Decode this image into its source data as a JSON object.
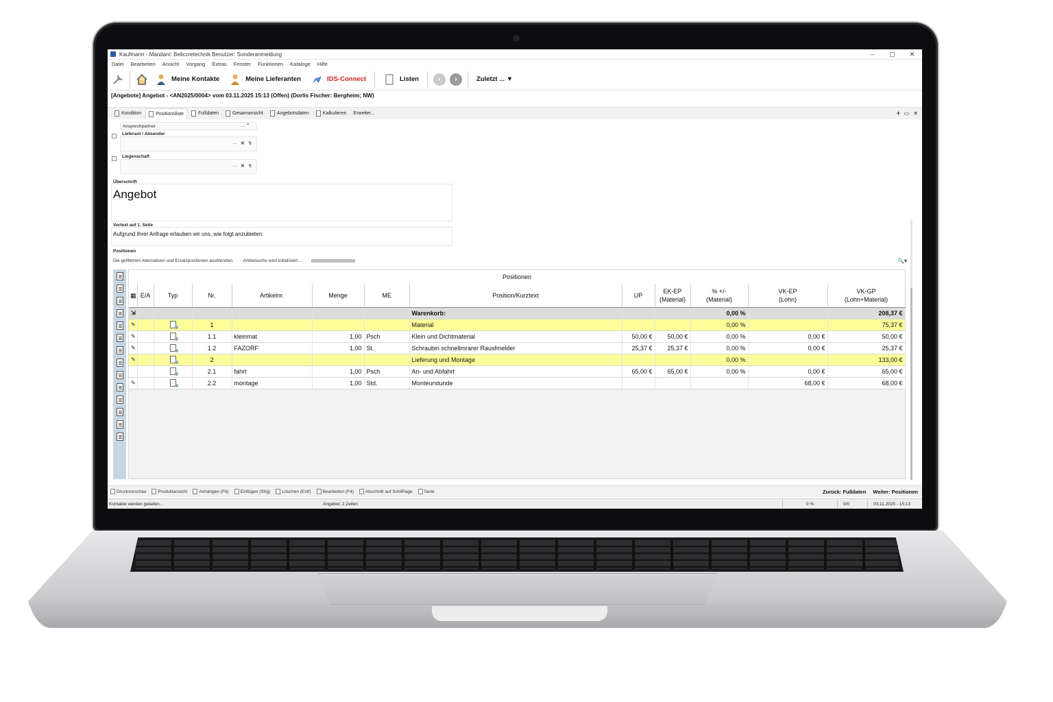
{
  "window": {
    "title": "Kaufmann - Mandant: Beliccretechnik Benutzer: Sonderanmeldung",
    "controls": [
      "–",
      "▢",
      "✕"
    ]
  },
  "menu": [
    "Datei",
    "Bearbeiten",
    "Ansicht",
    "Vorgang",
    "Extras",
    "Fenster",
    "Funktionen",
    "Kataloge",
    "Hilfe"
  ],
  "toolbar": {
    "contacts": "Meine Kontakte",
    "suppliers": "Meine Lieferanten",
    "ids": "IDS-Connect",
    "lists": "Listen",
    "recent": "Zuletzt ... ▼"
  },
  "document_line": "[Angebote] Angebot - <AN2025/0004> vom 03.11.2025 15:13 (Offen) (Dorlis Fischer: Bergheim; NW)",
  "tabs": [
    "Kondition",
    "Positionsliste",
    "Fußdaten",
    "Gesamansicht",
    "Angebotsdaten",
    "Kalkulieren",
    "Erweiter..."
  ],
  "form": {
    "ansprechpartner_label": "Ansprechpartner",
    "lieferant_label": "Lieferant / Absender",
    "liegenschaft_label": "Liegenschaft",
    "ueberschrift_label": "Überschrift",
    "ueberschrift_value": "Angebot",
    "vortext_label": "Vortext auf 1. Seite",
    "vortext_value": "Aufgrund Ihrer Anfrage erlauben wir uns, wie folgt anzubieten:",
    "positionen_label": "Positionen",
    "hint": "Die gefilterten Alternativen und Ersatzpositionen ausblenden.",
    "artikelsuche": "Artikelsuche wird initialisiert..."
  },
  "grid": {
    "caption": "Positionen",
    "headers": [
      "E/A",
      "Typ",
      "Nr.",
      "Artikelnr.",
      "Menge",
      "ME",
      "Position/Kurztext",
      "UP",
      "EK-EP\n(Material)",
      "% +/-\n(Material)",
      "VK-EP\n(Lohn)",
      "VK-GP\n(Lohn+Material)"
    ],
    "total": {
      "label": "Warenkorb:",
      "percent": "0,00 %",
      "sum": "208,37 €"
    },
    "rows": [
      {
        "style": "yellow",
        "nr": "1",
        "artikel": "",
        "menge": "",
        "me": "",
        "text": "Material",
        "up": "",
        "ek": "",
        "pct": "0,00 %",
        "vkep": "",
        "vkgp": "75,37 €"
      },
      {
        "style": "",
        "nr": "1.1",
        "artikel": "kleinmat",
        "menge": "1,00",
        "me": "Psch",
        "text": "Klein und Dichtmaterial",
        "up": "50,00 €",
        "ek": "50,00 €",
        "pct": "0,00 %",
        "vkep": "0,00 €",
        "vkgp": "50,00 €"
      },
      {
        "style": "",
        "nr": "1.2",
        "artikel": "FAZORF",
        "menge": "1,00",
        "me": "St.",
        "text": "Schraubin schnellmrarer Rausfmelder",
        "up": "25,37 €",
        "ek": "25,37 €",
        "pct": "0,00 %",
        "vkep": "0,00 €",
        "vkgp": "25,37 €"
      },
      {
        "style": "yellow",
        "nr": "2",
        "artikel": "",
        "menge": "",
        "me": "",
        "text": "Lieferung und Montage",
        "up": "",
        "ek": "",
        "pct": "0,00 %",
        "vkep": "",
        "vkgp": "133,00 €"
      },
      {
        "style": "",
        "nr": "2.1",
        "artikel": "fahrt",
        "menge": "1,00",
        "me": "Psch",
        "text": "An- und Abfahrt",
        "up": "65,00 €",
        "ek": "65,00 €",
        "pct": "0,00 %",
        "vkep": "0,00 €",
        "vkgp": "65,00 €"
      },
      {
        "style": "",
        "nr": "2.2",
        "artikel": "montage",
        "menge": "1,00",
        "me": "Std.",
        "text": "Monteurstunde",
        "up": "",
        "ek": "",
        "pct": "",
        "vkep": "68,00 €",
        "vkgp": "68,00 €"
      }
    ]
  },
  "actions": [
    "Druckvorschau",
    "Produktansicht",
    "Anhängen (F6)",
    "Einfügen (Strg)",
    "Löschen (Entf)",
    "Bearbeiten (F4)",
    "Abschnitt auf SchilPage",
    "Serie"
  ],
  "nav": {
    "back": "Zurück: Fußdaten",
    "next": "Weiter: Positionen"
  },
  "status": {
    "left": "Kontakte werden geladen...",
    "middle": "Angebot: 2 Zeilen",
    "progress": "0 %",
    "count": "0/0",
    "datetime": "03.11.2025 - 15:13"
  }
}
